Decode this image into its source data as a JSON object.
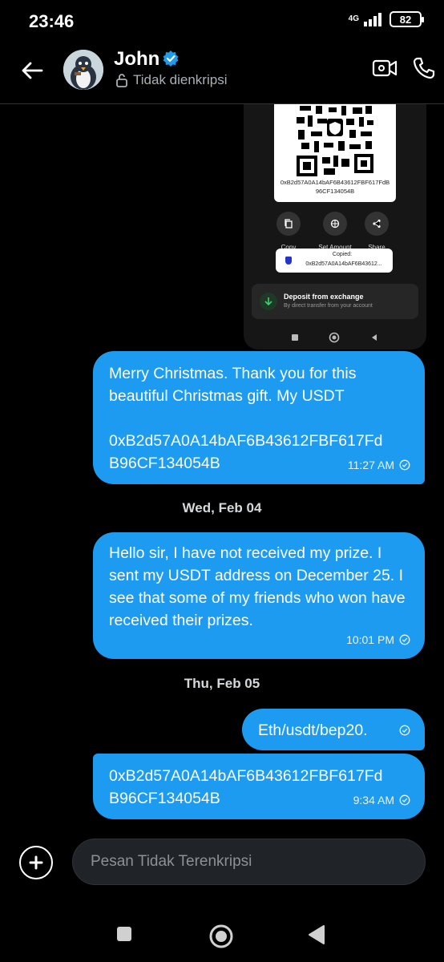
{
  "status_bar": {
    "time": "23:46",
    "network": "4G",
    "battery": "82"
  },
  "header": {
    "contact_name": "John",
    "encryption_status": "Tidak dienkripsi"
  },
  "shared_image": {
    "qr_address": "0xB2d57A0A14bAF6B43612FBF617FdB96CF134054B",
    "actions": [
      {
        "label": "Copy",
        "icon": "copy-icon"
      },
      {
        "label": "Set Amount",
        "icon": "target-icon"
      },
      {
        "label": "Share",
        "icon": "share-icon"
      }
    ],
    "toast": {
      "title": "Copied:",
      "address": "0xB2d57A0A14bAF6B43612..."
    },
    "deposit": {
      "title": "Deposit from exchange",
      "subtitle": "By direct transfer from your account"
    }
  },
  "messages": [
    {
      "text": "Merry Christmas. Thank you for this beautiful Christmas gift. My USDT\n\n0xB2d57A0A14bAF6B43612FBF617Fd B96CF134054B",
      "time": "11:27 AM"
    },
    {
      "text": "Hello sir, I have not received my prize. I sent my USDT address on December 25. I see that some of my friends who won have received their prizes.",
      "time": "10:01 PM"
    },
    {
      "text": "Eth/usdt/bep20.",
      "time": ""
    },
    {
      "text": "0xB2d57A0A14bAF6B43612FBF617Fd B96CF134054B",
      "time": "9:34 AM"
    }
  ],
  "date_separators": [
    "Wed, Feb 04",
    "Thu, Feb 05"
  ],
  "composer": {
    "placeholder": "Pesan Tidak Terenkripsi"
  },
  "colors": {
    "bubble": "#1d9bf0",
    "background": "#000000",
    "composer_bg": "#202327"
  }
}
